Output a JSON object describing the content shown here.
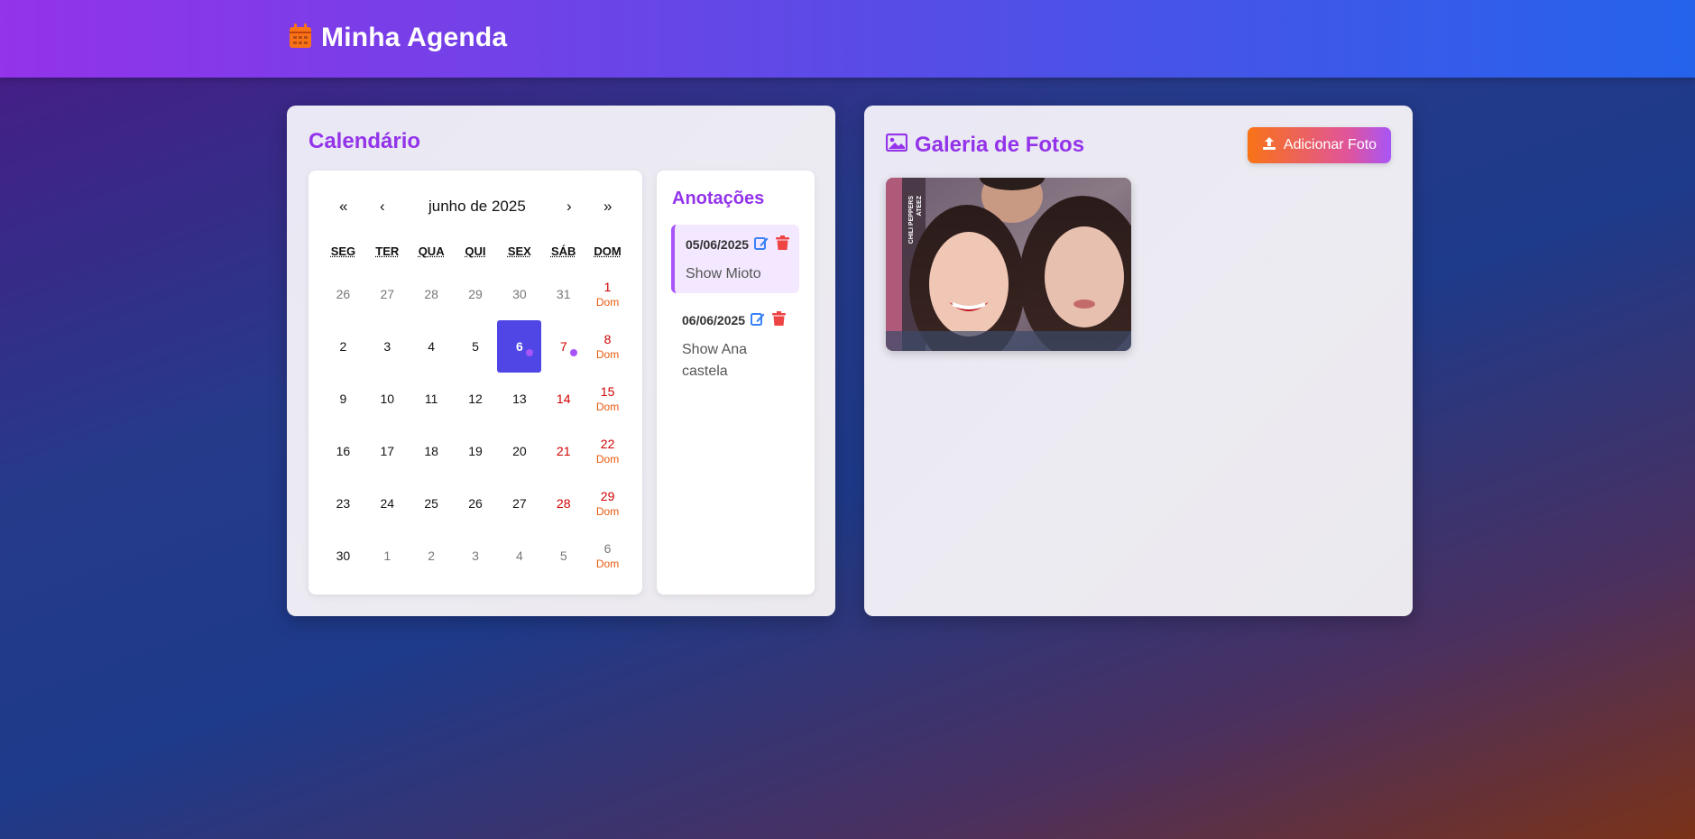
{
  "header": {
    "title": "Minha Agenda",
    "icon": "calendar-icon"
  },
  "calendar": {
    "title": "Calendário",
    "nav": {
      "first": "«",
      "prev": "‹",
      "month_label": "junho de 2025",
      "next": "›",
      "last": "»"
    },
    "weekdays": [
      "SEG",
      "TER",
      "QUA",
      "QUI",
      "SEX",
      "SÁB",
      "DOM"
    ],
    "weeks": [
      [
        {
          "n": "26",
          "t": "out"
        },
        {
          "n": "27",
          "t": "out"
        },
        {
          "n": "28",
          "t": "out"
        },
        {
          "n": "29",
          "t": "out"
        },
        {
          "n": "30",
          "t": "out"
        },
        {
          "n": "31",
          "t": "out"
        },
        {
          "n": "1",
          "t": "red",
          "sub": "Dom"
        }
      ],
      [
        {
          "n": "2"
        },
        {
          "n": "3"
        },
        {
          "n": "4"
        },
        {
          "n": "5"
        },
        {
          "n": "6",
          "t": "sel",
          "dot": true
        },
        {
          "n": "7",
          "t": "red",
          "dot": true
        },
        {
          "n": "8",
          "t": "red",
          "sub": "Dom"
        }
      ],
      [
        {
          "n": "9"
        },
        {
          "n": "10"
        },
        {
          "n": "11"
        },
        {
          "n": "12"
        },
        {
          "n": "13"
        },
        {
          "n": "14",
          "t": "red"
        },
        {
          "n": "15",
          "t": "red",
          "sub": "Dom"
        }
      ],
      [
        {
          "n": "16"
        },
        {
          "n": "17"
        },
        {
          "n": "18"
        },
        {
          "n": "19"
        },
        {
          "n": "20"
        },
        {
          "n": "21",
          "t": "red"
        },
        {
          "n": "22",
          "t": "red",
          "sub": "Dom"
        }
      ],
      [
        {
          "n": "23"
        },
        {
          "n": "24"
        },
        {
          "n": "25"
        },
        {
          "n": "26"
        },
        {
          "n": "27"
        },
        {
          "n": "28",
          "t": "red"
        },
        {
          "n": "29",
          "t": "red",
          "sub": "Dom"
        }
      ],
      [
        {
          "n": "30"
        },
        {
          "n": "1",
          "t": "out"
        },
        {
          "n": "2",
          "t": "out"
        },
        {
          "n": "3",
          "t": "out"
        },
        {
          "n": "4",
          "t": "out"
        },
        {
          "n": "5",
          "t": "out"
        },
        {
          "n": "6",
          "t": "out",
          "sub": "Dom"
        }
      ]
    ]
  },
  "notes": {
    "title": "Anotações",
    "items": [
      {
        "date": "05/06/2025",
        "text": "Show Mioto"
      },
      {
        "date": "06/06/2025",
        "text": "Show Ana castela"
      }
    ]
  },
  "gallery": {
    "title": "Galeria de Fotos",
    "add_button": "Adicionar Foto",
    "photo_caption_lines": [
      "CHILI PEPPERS",
      "ATEEZ"
    ]
  },
  "colors": {
    "accent": "#9333ea",
    "selected_day": "#4f46e5",
    "weekend": "#d10000",
    "sunday_label": "#e8590c",
    "edit_icon": "#3b82f6",
    "delete_icon": "#ef4444"
  }
}
